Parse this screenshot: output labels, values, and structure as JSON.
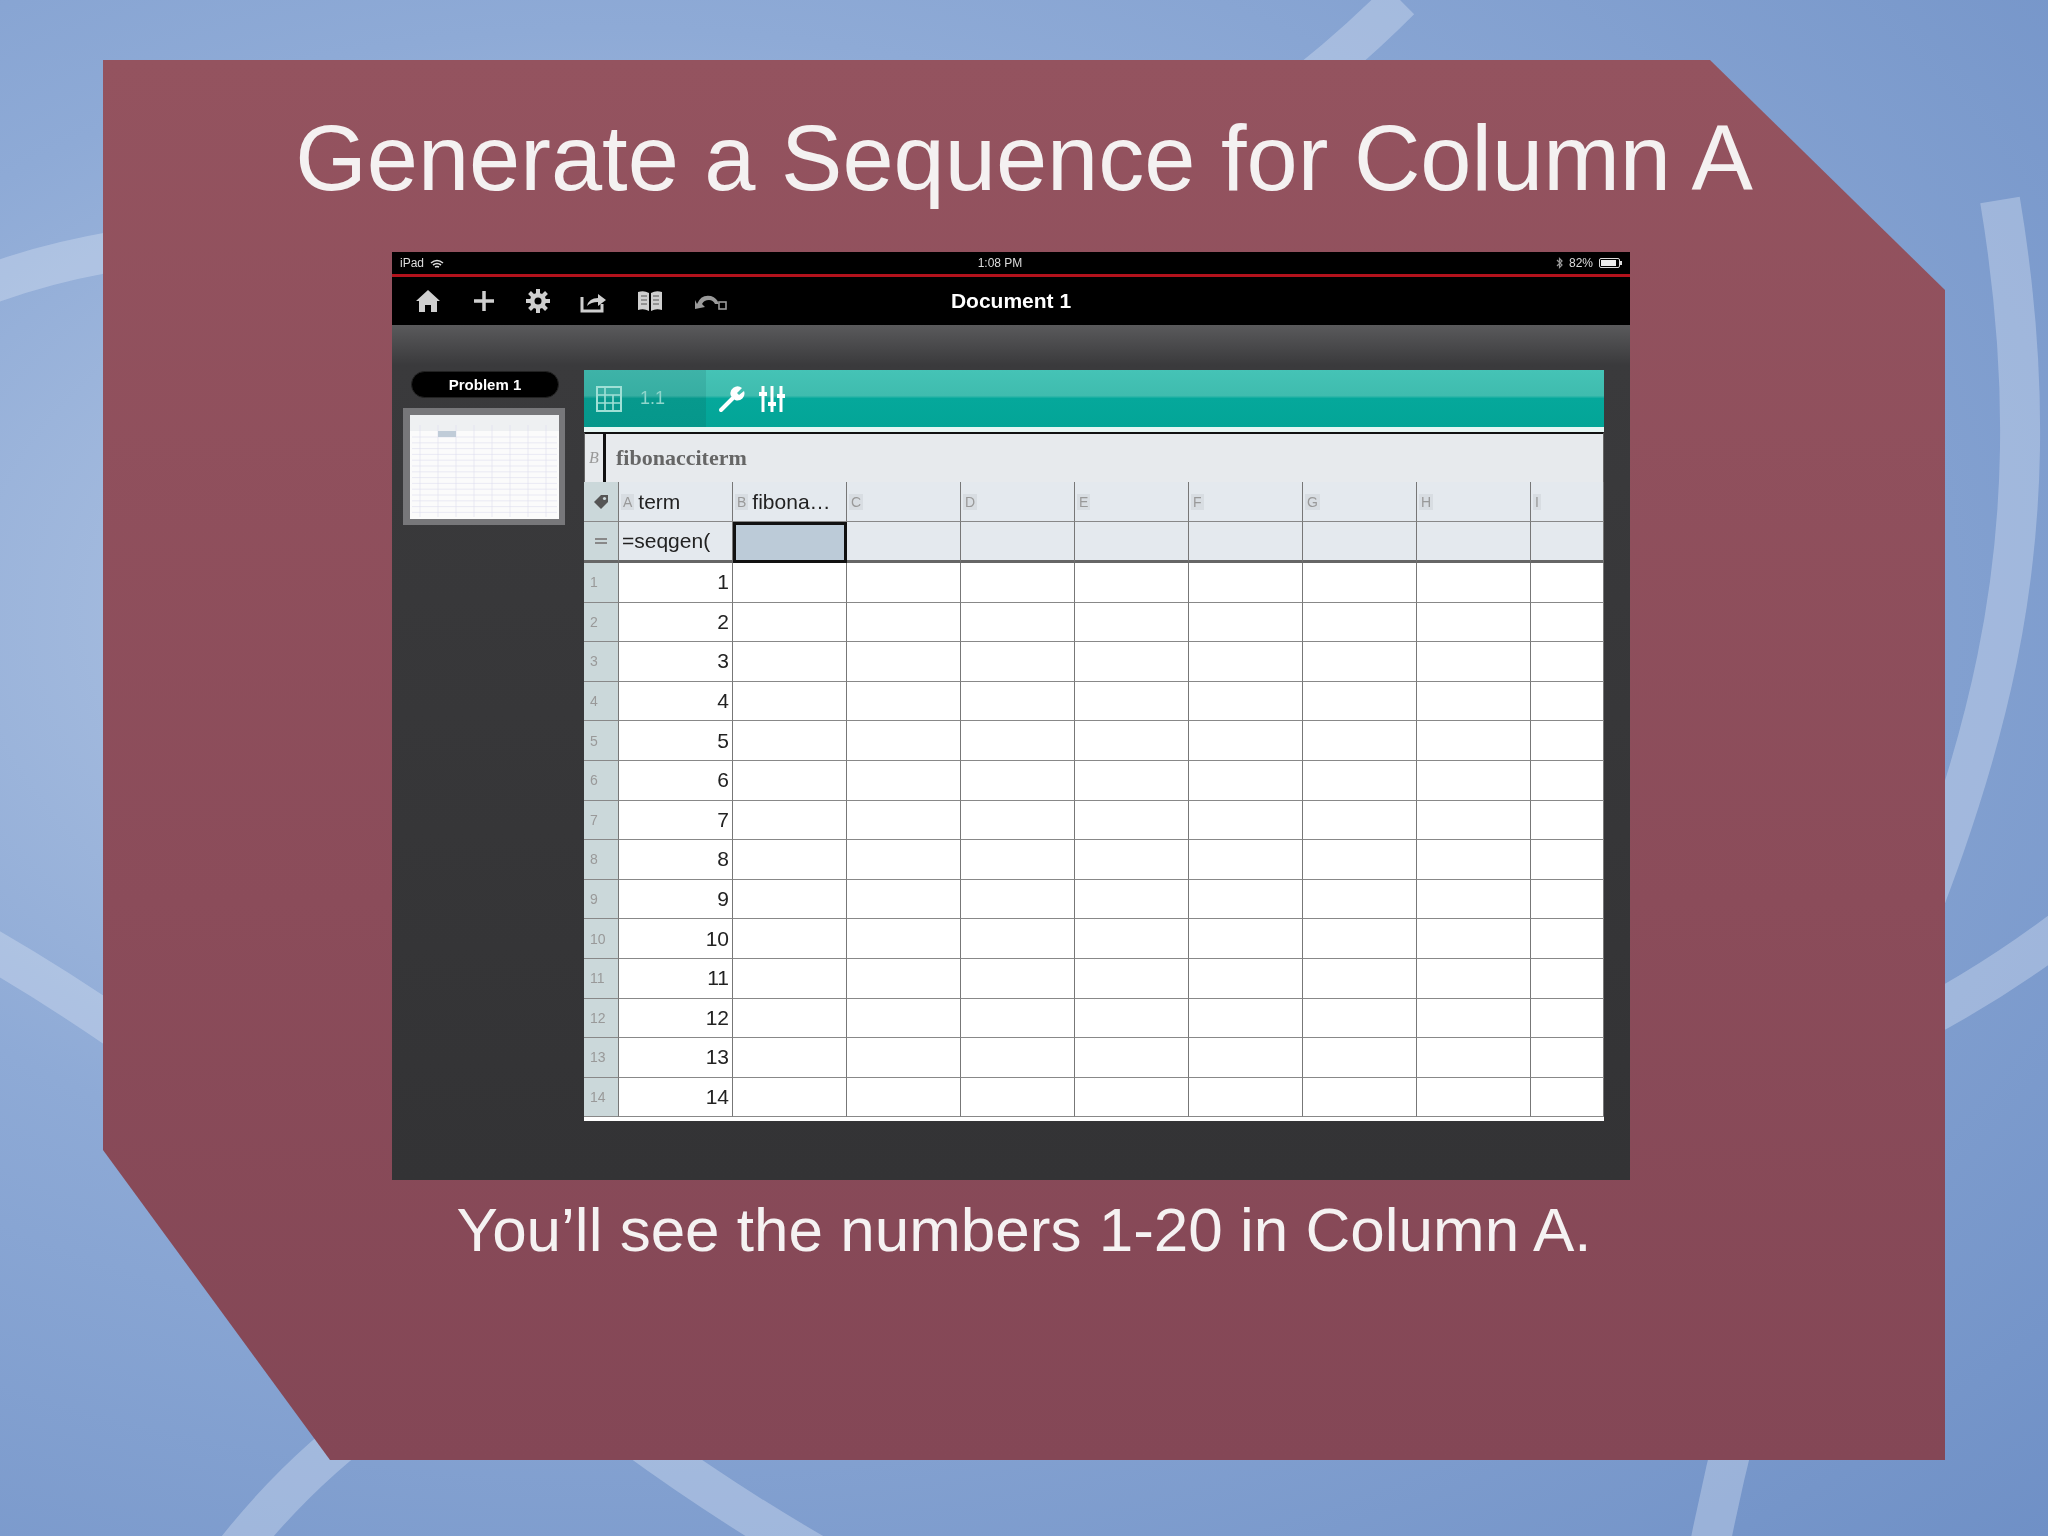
{
  "slide": {
    "title": "Generate a Sequence for Column A",
    "caption": "You’ll see the numbers 1-20 in Column A."
  },
  "status_bar": {
    "device": "iPad",
    "time": "1:08 PM",
    "battery": "82%"
  },
  "toolbar": {
    "title": "Document 1"
  },
  "sidebar": {
    "problem": "Problem 1"
  },
  "app_bar": {
    "page": "1.1"
  },
  "formula_bar": {
    "label": "B",
    "value": "fibonacciterm"
  },
  "table": {
    "columns": [
      {
        "letter": "A",
        "name": "term"
      },
      {
        "letter": "B",
        "name": "fibona…"
      },
      {
        "letter": "C"
      },
      {
        "letter": "D"
      },
      {
        "letter": "E"
      },
      {
        "letter": "F"
      },
      {
        "letter": "G"
      },
      {
        "letter": "H"
      },
      {
        "letter": "I"
      }
    ],
    "formula_row": [
      {
        "value": "=seqgen(",
        "selected": false
      },
      {
        "selected": true
      },
      {
        "selected": false
      },
      {
        "selected": false
      },
      {
        "selected": false
      },
      {
        "selected": false
      },
      {
        "selected": false
      },
      {
        "selected": false
      },
      {
        "selected": false
      }
    ],
    "rows": [
      {
        "number": "1",
        "a": "1"
      },
      {
        "number": "2",
        "a": "2"
      },
      {
        "number": "3",
        "a": "3"
      },
      {
        "number": "4",
        "a": "4"
      },
      {
        "number": "5",
        "a": "5"
      },
      {
        "number": "6",
        "a": "6"
      },
      {
        "number": "7",
        "a": "7"
      },
      {
        "number": "8",
        "a": "8"
      },
      {
        "number": "9",
        "a": "9"
      },
      {
        "number": "10",
        "a": "10"
      },
      {
        "number": "11",
        "a": "11"
      },
      {
        "number": "12",
        "a": "12"
      },
      {
        "number": "13",
        "a": "13"
      },
      {
        "number": "14",
        "a": "14"
      }
    ]
  }
}
